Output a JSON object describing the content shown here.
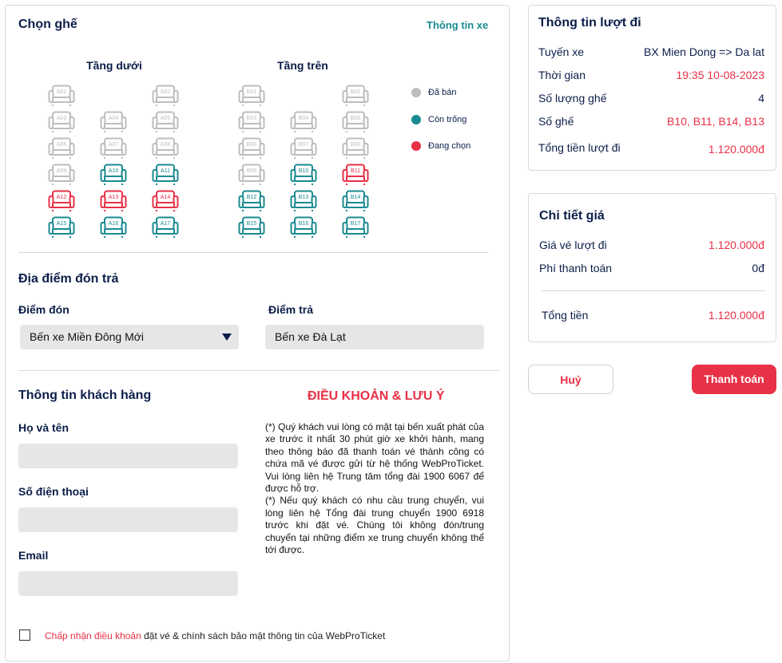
{
  "seat_section": {
    "title": "Chọn ghế",
    "vehicle_info_link": "Thông tin xe",
    "lower_deck_title": "Tầng dưới",
    "upper_deck_title": "Tầng trên",
    "legend": [
      {
        "label": "Đã bán",
        "color": "#bdbdbd"
      },
      {
        "label": "Còn trống",
        "color": "#1a8a91"
      },
      {
        "label": "Đang chọn",
        "color": "#e83046"
      }
    ],
    "status_colors": {
      "sold": "#bdbdbd",
      "available": "#1a8a91",
      "selected": "#e83046"
    },
    "lower_deck": [
      [
        "A01",
        null,
        "A02"
      ],
      [
        "A03",
        "A04",
        "A05"
      ],
      [
        "A06",
        "A07",
        "A08"
      ],
      [
        "A09",
        "A10",
        "A11"
      ],
      [
        "A12",
        "A13",
        "A14"
      ],
      [
        "A15",
        "A16",
        "A17"
      ]
    ],
    "upper_deck": [
      [
        "B01",
        null,
        "B02"
      ],
      [
        "B03",
        "B04",
        "B05"
      ],
      [
        "B06",
        "B07",
        "B08"
      ],
      [
        "B09",
        "B10",
        "B11"
      ],
      [
        "B12",
        "B13",
        "B14"
      ],
      [
        "B15",
        "B16",
        "B17"
      ]
    ],
    "seat_status": {
      "A01": "sold",
      "A02": "sold",
      "A03": "sold",
      "A04": "sold",
      "A05": "sold",
      "A06": "sold",
      "A07": "sold",
      "A08": "sold",
      "A09": "sold",
      "A10": "available",
      "A11": "available",
      "A12": "selected",
      "A13": "selected",
      "A14": "selected",
      "A15": "available",
      "A16": "available",
      "A17": "available",
      "B01": "sold",
      "B02": "sold",
      "B03": "sold",
      "B04": "sold",
      "B05": "sold",
      "B06": "sold",
      "B07": "sold",
      "B08": "sold",
      "B09": "sold",
      "B10": "available",
      "B11": "selected",
      "B12": "available",
      "B13": "available",
      "B14": "available",
      "B15": "available",
      "B16": "available",
      "B17": "available"
    }
  },
  "pickup_section": {
    "title": "Địa điểm đón trả",
    "pickup_label": "Điểm đón",
    "pickup_value": "Bến xe Miền Đông Mới",
    "dropoff_label": "Điểm trả",
    "dropoff_value": "Bến xe Đà Lạt"
  },
  "customer_section": {
    "title": "Thông tin khách hàng",
    "name_label": "Họ và tên",
    "phone_label": "Số điện thoại",
    "email_label": "Email",
    "name_value": "",
    "phone_value": "",
    "email_value": ""
  },
  "terms": {
    "title": "ĐIỀU KHOẢN & LƯU Ý",
    "paragraph1": "(*) Quý khách vui lòng có mặt tại bến xuất phát của xe trước ít nhất 30 phút giờ xe khởi hành, mang theo thông báo đã thanh toán vé thành công có chứa mã vé được gửi từ hệ thống WebProTicket. Vui lòng liên hệ Trung tâm tổng đài 1900 6067 để được hỗ trợ.",
    "paragraph2": "(*) Nếu quý khách có nhu cầu trung chuyển, vui lòng liên hệ Tổng đài trung chuyển 1900 6918 trước khi đặt vé. Chúng tôi không đón/trung chuyển tại những điểm xe trung chuyển không thể tới được.",
    "accept_link": "Chấp nhận điều khoản",
    "accept_rest": " đặt vé & chính sách bảo mật thông tin của WebProTicket"
  },
  "trip_info": {
    "title": "Thông tin lượt đi",
    "rows": [
      {
        "label": "Tuyến xe",
        "value": "BX Mien Dong => Da lat"
      },
      {
        "label": "Thời gian",
        "value": "19:35 10-08-2023"
      },
      {
        "label": "Số lượng ghế",
        "value": "4"
      },
      {
        "label": "Số ghế",
        "value": "B10, B11, B14, B13"
      },
      {
        "label": "Tổng tiền lượt đi",
        "value": "1.120.000đ"
      }
    ]
  },
  "price_detail": {
    "title": "Chi tiết giá",
    "rows": [
      {
        "label": "Giá vé lượt đi",
        "value": "1.120.000đ"
      },
      {
        "label": "Phí thanh toán",
        "value": "0đ"
      }
    ],
    "total_label": "Tổng tiền",
    "total_value": "1.120.000đ"
  },
  "actions": {
    "cancel": "Huỷ",
    "pay": "Thanh toán"
  }
}
